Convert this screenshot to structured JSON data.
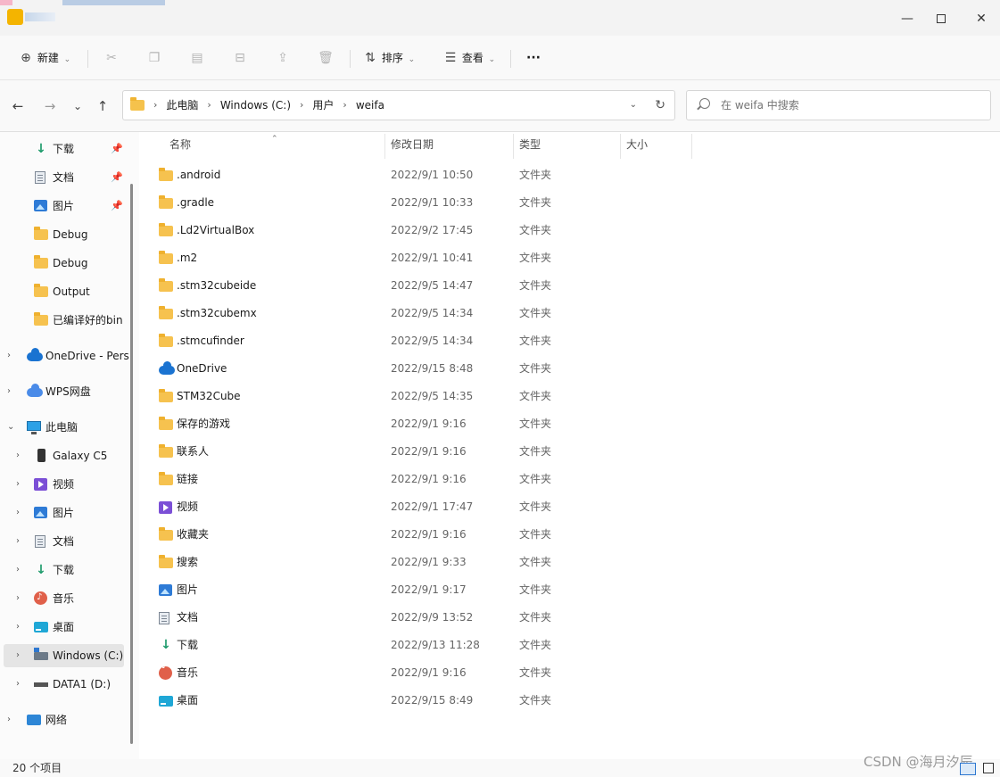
{
  "window": {
    "minimize": "—",
    "close": "✕"
  },
  "toolbar": {
    "new_label": "新建",
    "sort_label": "排序",
    "view_label": "查看",
    "more_label": "···"
  },
  "nav": {
    "back": "←",
    "forward": "→",
    "recent": "⌄",
    "up": "↑"
  },
  "address": {
    "crumbs": [
      "此电脑",
      "Windows (C:)",
      "用户",
      "weifa"
    ],
    "separator": "›"
  },
  "search": {
    "placeholder": "在 weifa 中搜索"
  },
  "sidebar": {
    "quick": [
      {
        "label": "下载",
        "icon": "download-icon"
      },
      {
        "label": "文档",
        "icon": "document-icon"
      },
      {
        "label": "图片",
        "icon": "picture-icon"
      },
      {
        "label": "Debug",
        "icon": "folder-icon"
      },
      {
        "label": "Debug",
        "icon": "folder-icon"
      },
      {
        "label": "Output",
        "icon": "folder-icon"
      },
      {
        "label": "已编译好的bin",
        "icon": "folder-icon"
      }
    ],
    "onedrive": "OneDrive - Pers",
    "wps": "WPS网盘",
    "this_pc": "此电脑",
    "pc_children": [
      {
        "label": "Galaxy C5",
        "icon": "phone-icon"
      },
      {
        "label": "视频",
        "icon": "video-icon"
      },
      {
        "label": "图片",
        "icon": "picture-icon"
      },
      {
        "label": "文档",
        "icon": "document-icon"
      },
      {
        "label": "下载",
        "icon": "download-icon"
      },
      {
        "label": "音乐",
        "icon": "music-icon"
      },
      {
        "label": "桌面",
        "icon": "desktop-icon"
      },
      {
        "label": "Windows (C:)",
        "icon": "drive-c-icon"
      },
      {
        "label": "DATA1 (D:)",
        "icon": "drive-d-icon"
      }
    ],
    "network": "网络"
  },
  "columns": {
    "name": "名称",
    "date": "修改日期",
    "type": "类型",
    "size": "大小"
  },
  "files": [
    {
      "name": ".android",
      "date": "2022/9/1 10:50",
      "type": "文件夹",
      "icon": "folder-icon"
    },
    {
      "name": ".gradle",
      "date": "2022/9/1 10:33",
      "type": "文件夹",
      "icon": "folder-icon"
    },
    {
      "name": ".Ld2VirtualBox",
      "date": "2022/9/2 17:45",
      "type": "文件夹",
      "icon": "folder-icon"
    },
    {
      "name": ".m2",
      "date": "2022/9/1 10:41",
      "type": "文件夹",
      "icon": "folder-icon"
    },
    {
      "name": ".stm32cubeide",
      "date": "2022/9/5 14:47",
      "type": "文件夹",
      "icon": "folder-icon"
    },
    {
      "name": ".stm32cubemx",
      "date": "2022/9/5 14:34",
      "type": "文件夹",
      "icon": "folder-icon"
    },
    {
      "name": ".stmcufinder",
      "date": "2022/9/5 14:34",
      "type": "文件夹",
      "icon": "folder-icon"
    },
    {
      "name": "OneDrive",
      "date": "2022/9/15 8:48",
      "type": "文件夹",
      "icon": "cloud-icon"
    },
    {
      "name": "STM32Cube",
      "date": "2022/9/5 14:35",
      "type": "文件夹",
      "icon": "folder-icon"
    },
    {
      "name": "保存的游戏",
      "date": "2022/9/1 9:16",
      "type": "文件夹",
      "icon": "folder-icon"
    },
    {
      "name": "联系人",
      "date": "2022/9/1 9:16",
      "type": "文件夹",
      "icon": "folder-icon"
    },
    {
      "name": "链接",
      "date": "2022/9/1 9:16",
      "type": "文件夹",
      "icon": "folder-icon"
    },
    {
      "name": "视频",
      "date": "2022/9/1 17:47",
      "type": "文件夹",
      "icon": "video-icon"
    },
    {
      "name": "收藏夹",
      "date": "2022/9/1 9:16",
      "type": "文件夹",
      "icon": "folder-icon"
    },
    {
      "name": "搜索",
      "date": "2022/9/1 9:33",
      "type": "文件夹",
      "icon": "folder-icon"
    },
    {
      "name": "图片",
      "date": "2022/9/1 9:17",
      "type": "文件夹",
      "icon": "picture-icon"
    },
    {
      "name": "文档",
      "date": "2022/9/9 13:52",
      "type": "文件夹",
      "icon": "document-icon"
    },
    {
      "name": "下载",
      "date": "2022/9/13 11:28",
      "type": "文件夹",
      "icon": "download-icon"
    },
    {
      "name": "音乐",
      "date": "2022/9/1 9:16",
      "type": "文件夹",
      "icon": "music-icon"
    },
    {
      "name": "桌面",
      "date": "2022/9/15 8:49",
      "type": "文件夹",
      "icon": "desktop-icon"
    }
  ],
  "status": {
    "item_count": "20 个项目"
  },
  "watermark": "CSDN @海月汐辰"
}
